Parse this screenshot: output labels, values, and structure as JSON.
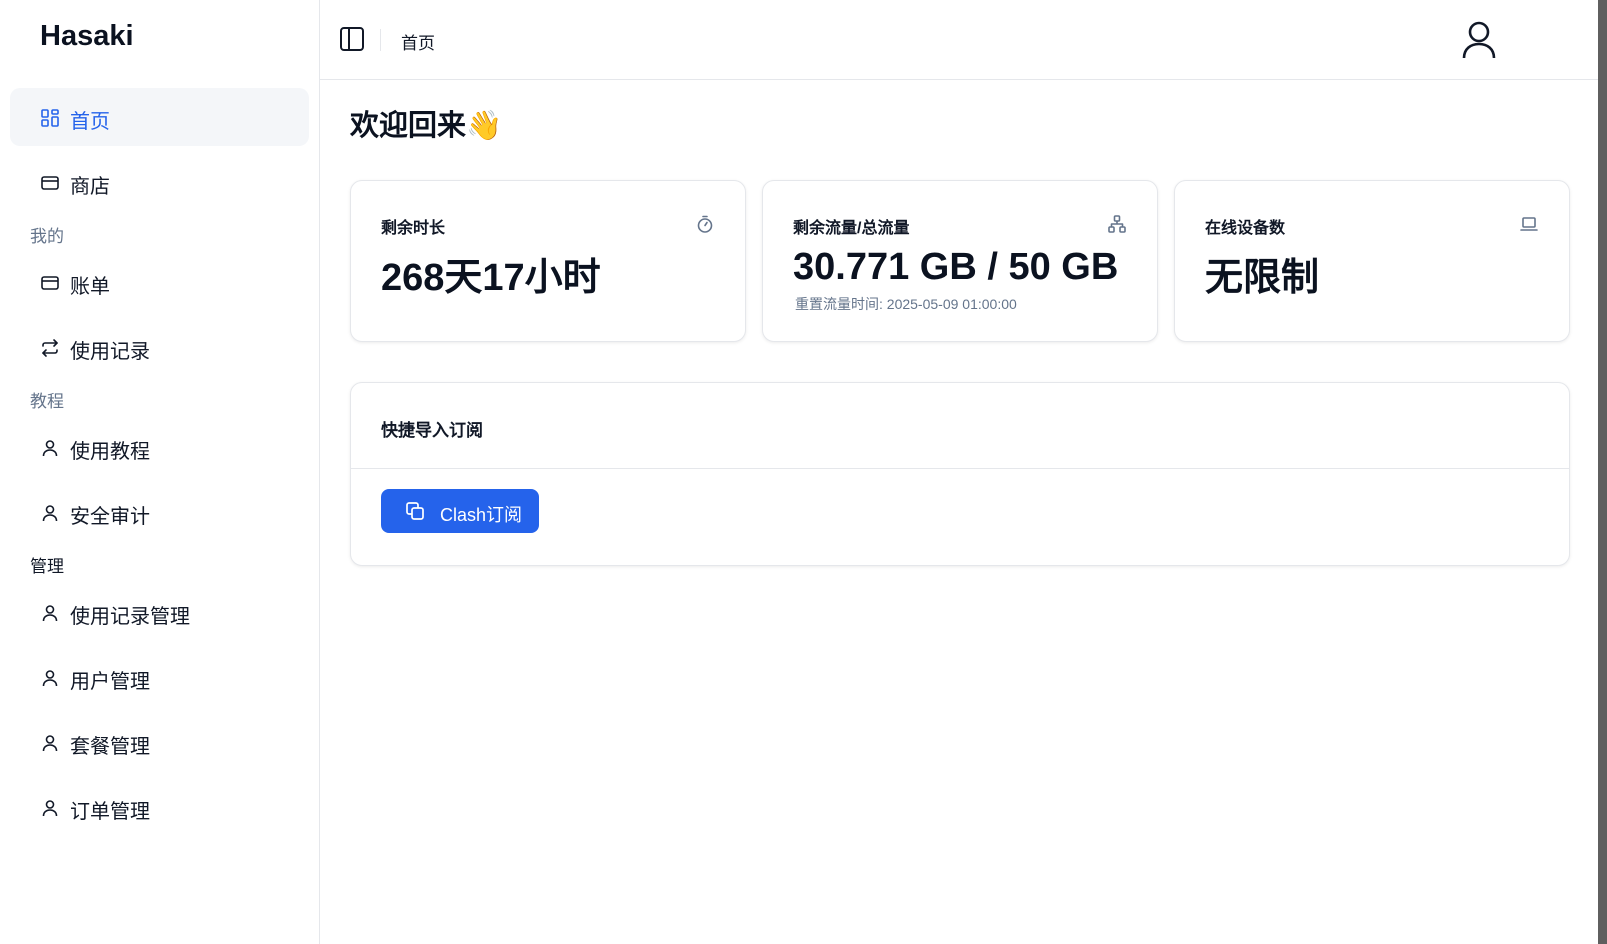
{
  "app": {
    "brand": "Hasaki"
  },
  "colors": {
    "accent": "#2563eb",
    "active_bg": "#f4f6f9",
    "muted_text": "#64748b",
    "border": "#e5e7eb"
  },
  "sidebar": {
    "items": [
      {
        "label": "首页",
        "icon": "dashboard-grid-icon",
        "active": true
      },
      {
        "label": "商店",
        "icon": "credit-card-icon"
      }
    ],
    "sections": [
      {
        "label": "我的",
        "items": [
          {
            "label": "账单",
            "icon": "credit-card-icon"
          },
          {
            "label": "使用记录",
            "icon": "arrows-exchange-icon"
          }
        ]
      },
      {
        "label": "教程",
        "items": [
          {
            "label": "使用教程",
            "icon": "user-icon"
          },
          {
            "label": "安全审计",
            "icon": "user-icon"
          }
        ]
      },
      {
        "label": "管理",
        "items": [
          {
            "label": "使用记录管理",
            "icon": "user-icon"
          },
          {
            "label": "用户管理",
            "icon": "user-icon"
          },
          {
            "label": "套餐管理",
            "icon": "user-icon"
          },
          {
            "label": "订单管理",
            "icon": "user-icon"
          }
        ]
      }
    ]
  },
  "header": {
    "breadcrumb": "首页",
    "toggle_icon": "sidebar-toggle-icon",
    "user_icon": "user-avatar-icon"
  },
  "main": {
    "welcome": "欢迎回来",
    "welcome_emoji": "👋",
    "stats": [
      {
        "title": "剩余时长",
        "value": "268天17小时",
        "icon": "timer-icon"
      },
      {
        "title": "剩余流量/总流量",
        "value": "30.771 GB / 50 GB",
        "subtext": "重置流量时间: 2025-05-09 01:00:00",
        "icon": "network-icon"
      },
      {
        "title": "在线设备数",
        "value": "无限制",
        "icon": "laptop-icon"
      }
    ],
    "subscribe": {
      "title": "快捷导入订阅",
      "button_label": "Clash订阅",
      "button_icon": "copy-icon"
    }
  }
}
